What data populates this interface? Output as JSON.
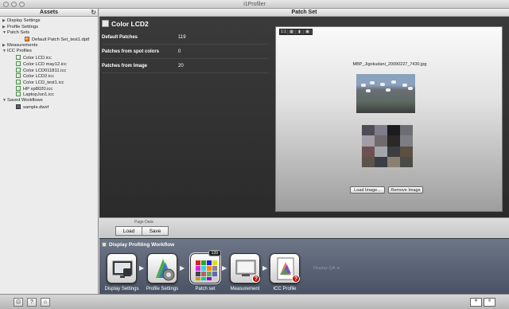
{
  "window": {
    "title": "i1Profiler"
  },
  "sidebar": {
    "title": "Assets",
    "tree": [
      {
        "label": "Display Settings",
        "level": 0,
        "tri": "▶",
        "icon": ""
      },
      {
        "label": "Profile Settings",
        "level": 0,
        "tri": "▶",
        "icon": ""
      },
      {
        "label": "Patch Sets",
        "level": 0,
        "tri": "▼",
        "icon": ""
      },
      {
        "label": "Default Patch Set_test1.dptf",
        "level": 2,
        "tri": "",
        "icon": "dptf"
      },
      {
        "label": "Measurements",
        "level": 0,
        "tri": "▶",
        "icon": ""
      },
      {
        "label": "ICC Profiles",
        "level": 0,
        "tri": "▼",
        "icon": ""
      },
      {
        "label": "Color LCD.icc",
        "level": 1,
        "tri": "",
        "icon": "icc"
      },
      {
        "label": "Color LCD may12.icc",
        "level": 1,
        "tri": "",
        "icon": "icc"
      },
      {
        "label": "Color LCD011811.icc",
        "level": 1,
        "tri": "",
        "icon": "icc"
      },
      {
        "label": "Color LCD2.icc",
        "level": 1,
        "tri": "",
        "icon": "icc"
      },
      {
        "label": "Color LCD_test1.icc",
        "level": 1,
        "tri": "",
        "icon": "icc"
      },
      {
        "label": "HP xp8020.icc",
        "level": 1,
        "tri": "",
        "icon": "icc"
      },
      {
        "label": "LaptopJun1.icc",
        "level": 1,
        "tri": "",
        "icon": "icc"
      },
      {
        "label": "Saved Workflows",
        "level": 0,
        "tri": "▼",
        "icon": ""
      },
      {
        "label": "sample.dwxf",
        "level": 1,
        "tri": "",
        "icon": "dwxf"
      }
    ]
  },
  "main": {
    "header": "Patch Set",
    "panel_title": "Color LCD2",
    "rows": [
      {
        "label": "Default Patches",
        "value": "119"
      },
      {
        "label": "Patches from spot colors",
        "value": "0"
      },
      {
        "label": "Patches from Image",
        "value": "20"
      }
    ],
    "preview": {
      "filename": "MBP_Jigokudani_20090227_7430.jpg",
      "tools": [
        "1:1",
        "▦",
        "▮",
        "▣"
      ],
      "load_image": "Load Image...",
      "remove_image": "Remove Image",
      "patch_colors": [
        "#4e4d55",
        "#807c8a",
        "#1c1b1f",
        "#6c6e73",
        "#a39ea5",
        "#6f6a6c",
        "#2b2927",
        "#7b7e83",
        "#6f5052",
        "#a3a6ab",
        "#3c3d42",
        "#5c5041",
        "#5b5449",
        "#3a3d45",
        "#8b7f6f",
        "#4a4b45"
      ]
    }
  },
  "page_data": {
    "label": "Page Data",
    "load": "Load",
    "save": "Save"
  },
  "workflow": {
    "title": "Display Profiling Workflow",
    "steps": [
      {
        "label": "Display Settings"
      },
      {
        "label": "Profile Settings"
      },
      {
        "label": "Patch set",
        "count": "139"
      },
      {
        "label": "Measurement"
      },
      {
        "label": "ICC Profile"
      }
    ],
    "display_qa": "Display QA"
  },
  "bottom": {
    "buttons": [
      "⊡",
      "?",
      "⌂"
    ]
  }
}
